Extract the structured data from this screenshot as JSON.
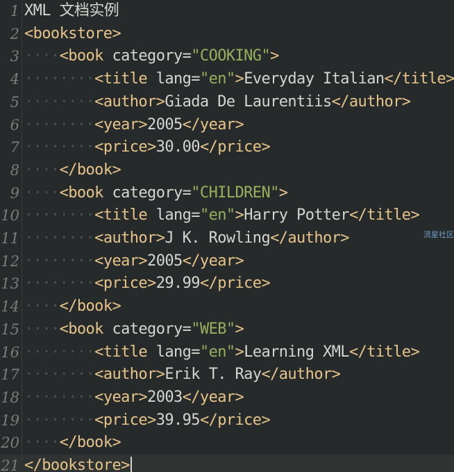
{
  "editor": {
    "lines": [
      {
        "num": "1",
        "segments": [
          {
            "t": "XML 文档实例",
            "c": "plain"
          }
        ]
      },
      {
        "num": "2",
        "segments": [
          {
            "t": "<bookstore>",
            "c": "tag"
          }
        ]
      },
      {
        "num": "3",
        "segments": [
          {
            "t": "····",
            "c": "ws"
          },
          {
            "t": "<book ",
            "c": "tag"
          },
          {
            "t": "category=",
            "c": "attr"
          },
          {
            "t": "\"COOKING\"",
            "c": "str"
          },
          {
            "t": ">",
            "c": "tag"
          }
        ]
      },
      {
        "num": "4",
        "segments": [
          {
            "t": "········",
            "c": "ws"
          },
          {
            "t": "<title ",
            "c": "tag"
          },
          {
            "t": "lang=",
            "c": "attr"
          },
          {
            "t": "\"en\"",
            "c": "str"
          },
          {
            "t": ">",
            "c": "tag"
          },
          {
            "t": "Everyday Italian",
            "c": "text"
          },
          {
            "t": "</title>",
            "c": "tag"
          }
        ]
      },
      {
        "num": "5",
        "segments": [
          {
            "t": "········",
            "c": "ws"
          },
          {
            "t": "<author>",
            "c": "tag"
          },
          {
            "t": "Giada De Laurentiis",
            "c": "text"
          },
          {
            "t": "</author>",
            "c": "tag"
          }
        ]
      },
      {
        "num": "6",
        "segments": [
          {
            "t": "········",
            "c": "ws"
          },
          {
            "t": "<year>",
            "c": "tag"
          },
          {
            "t": "2005",
            "c": "text"
          },
          {
            "t": "</year>",
            "c": "tag"
          }
        ]
      },
      {
        "num": "7",
        "segments": [
          {
            "t": "········",
            "c": "ws"
          },
          {
            "t": "<price>",
            "c": "tag"
          },
          {
            "t": "30.00",
            "c": "text"
          },
          {
            "t": "</price>",
            "c": "tag"
          }
        ]
      },
      {
        "num": "8",
        "segments": [
          {
            "t": "····",
            "c": "ws"
          },
          {
            "t": "</book>",
            "c": "tag"
          }
        ]
      },
      {
        "num": "9",
        "segments": [
          {
            "t": "····",
            "c": "ws"
          },
          {
            "t": "<book ",
            "c": "tag"
          },
          {
            "t": "category=",
            "c": "attr"
          },
          {
            "t": "\"CHILDREN\"",
            "c": "str"
          },
          {
            "t": ">",
            "c": "tag"
          }
        ]
      },
      {
        "num": "10",
        "segments": [
          {
            "t": "········",
            "c": "ws"
          },
          {
            "t": "<title ",
            "c": "tag"
          },
          {
            "t": "lang=",
            "c": "attr"
          },
          {
            "t": "\"en\"",
            "c": "str"
          },
          {
            "t": ">",
            "c": "tag"
          },
          {
            "t": "Harry Potter",
            "c": "text"
          },
          {
            "t": "</title>",
            "c": "tag"
          }
        ]
      },
      {
        "num": "11",
        "segments": [
          {
            "t": "········",
            "c": "ws"
          },
          {
            "t": "<author>",
            "c": "tag"
          },
          {
            "t": "J K. Rowling",
            "c": "text"
          },
          {
            "t": "</author>",
            "c": "tag"
          }
        ]
      },
      {
        "num": "12",
        "segments": [
          {
            "t": "········",
            "c": "ws"
          },
          {
            "t": "<year>",
            "c": "tag"
          },
          {
            "t": "2005",
            "c": "text"
          },
          {
            "t": "</year>",
            "c": "tag"
          }
        ]
      },
      {
        "num": "13",
        "segments": [
          {
            "t": "········",
            "c": "ws"
          },
          {
            "t": "<price>",
            "c": "tag"
          },
          {
            "t": "29.99",
            "c": "text"
          },
          {
            "t": "</price>",
            "c": "tag"
          }
        ]
      },
      {
        "num": "14",
        "segments": [
          {
            "t": "····",
            "c": "ws"
          },
          {
            "t": "</book>",
            "c": "tag"
          }
        ]
      },
      {
        "num": "15",
        "segments": [
          {
            "t": "····",
            "c": "ws"
          },
          {
            "t": "<book ",
            "c": "tag"
          },
          {
            "t": "category=",
            "c": "attr"
          },
          {
            "t": "\"WEB\"",
            "c": "str"
          },
          {
            "t": ">",
            "c": "tag"
          }
        ]
      },
      {
        "num": "16",
        "segments": [
          {
            "t": "········",
            "c": "ws"
          },
          {
            "t": "<title ",
            "c": "tag"
          },
          {
            "t": "lang=",
            "c": "attr"
          },
          {
            "t": "\"en\"",
            "c": "str"
          },
          {
            "t": ">",
            "c": "tag"
          },
          {
            "t": "Learning XML",
            "c": "text"
          },
          {
            "t": "</title>",
            "c": "tag"
          }
        ]
      },
      {
        "num": "17",
        "segments": [
          {
            "t": "········",
            "c": "ws"
          },
          {
            "t": "<author>",
            "c": "tag"
          },
          {
            "t": "Erik T. Ray",
            "c": "text"
          },
          {
            "t": "</author>",
            "c": "tag"
          }
        ]
      },
      {
        "num": "18",
        "segments": [
          {
            "t": "········",
            "c": "ws"
          },
          {
            "t": "<year>",
            "c": "tag"
          },
          {
            "t": "2003",
            "c": "text"
          },
          {
            "t": "</year>",
            "c": "tag"
          }
        ]
      },
      {
        "num": "19",
        "segments": [
          {
            "t": "········",
            "c": "ws"
          },
          {
            "t": "<price>",
            "c": "tag"
          },
          {
            "t": "39.95",
            "c": "text"
          },
          {
            "t": "</price>",
            "c": "tag"
          }
        ]
      },
      {
        "num": "20",
        "segments": [
          {
            "t": "····",
            "c": "ws"
          },
          {
            "t": "</book>",
            "c": "tag"
          }
        ]
      },
      {
        "num": "21",
        "segments": [
          {
            "t": "</bookstore>",
            "c": "tag"
          }
        ]
      }
    ],
    "current_line": "21"
  },
  "watermark": "流星社区",
  "colors": {
    "background": "#262a2b",
    "tag": "#e6c48a",
    "string": "#97b05e",
    "text": "#d4d6cf",
    "line_number": "#7a7e78"
  }
}
